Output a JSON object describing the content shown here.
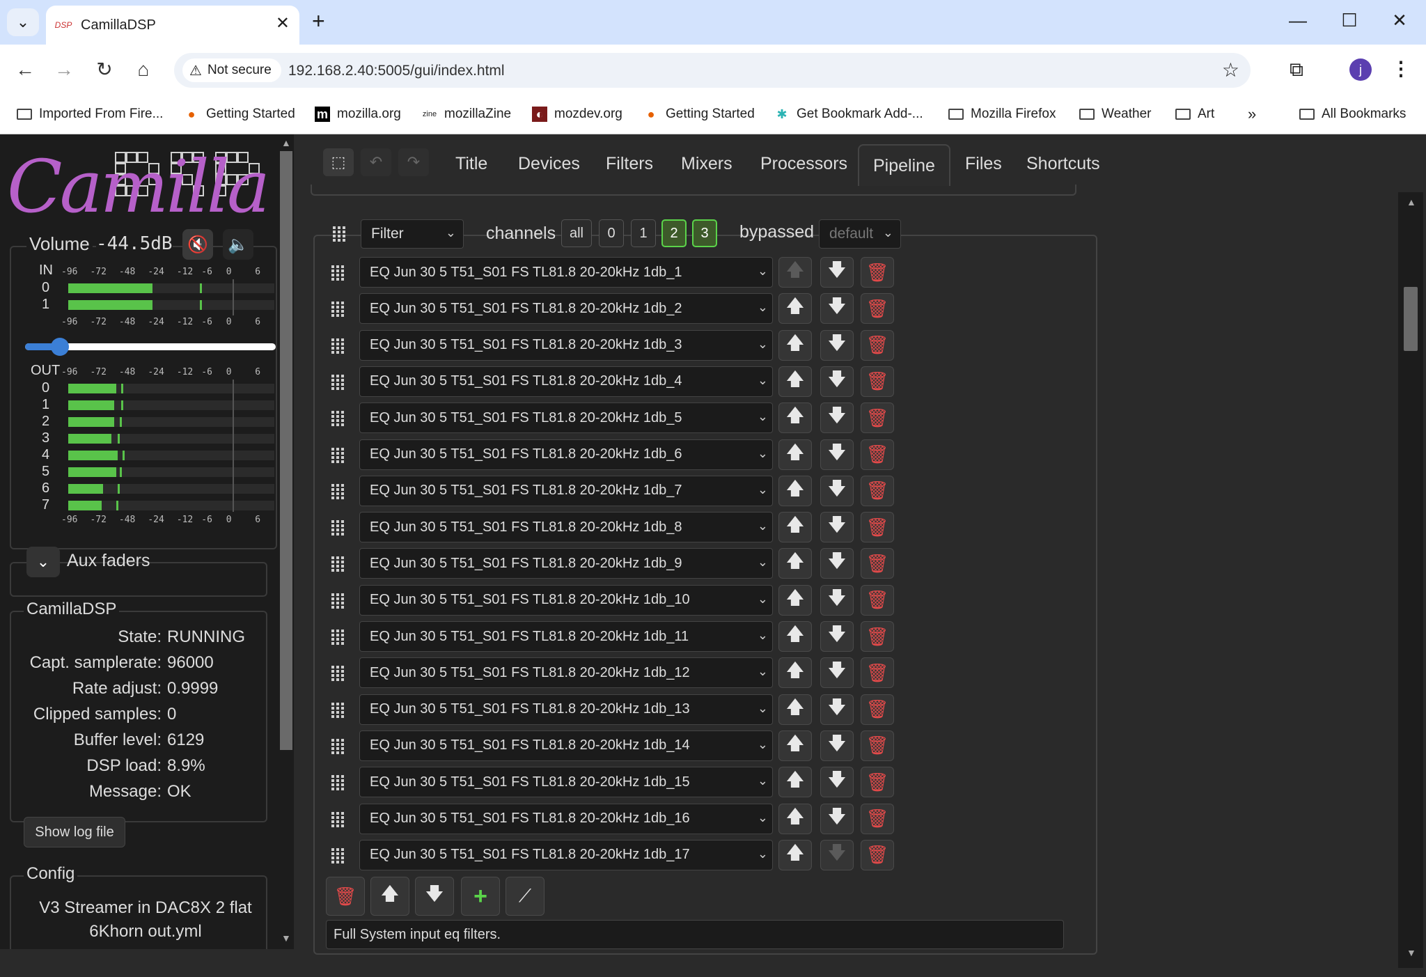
{
  "browser": {
    "tab_title": "CamillaDSP",
    "tab_favicon_text": "DSP",
    "security_label": "Not secure",
    "url": "192.168.2.40:5005/gui/index.html",
    "avatar_letter": "j",
    "bookmarks": [
      {
        "label": "Imported From Fire...",
        "icon": "folder-icon"
      },
      {
        "label": "Getting Started",
        "icon": "firefox-icon"
      },
      {
        "label": "mozilla.org",
        "icon": "mozilla-m-icon"
      },
      {
        "label": "mozillaZine",
        "icon": "mozillazine-icon"
      },
      {
        "label": "mozdev.org",
        "icon": "mozdev-icon"
      },
      {
        "label": "Getting Started",
        "icon": "firefox-icon"
      },
      {
        "label": "Get Bookmark Add-...",
        "icon": "puzzle-icon"
      },
      {
        "label": "Mozilla Firefox",
        "icon": "folder-icon"
      },
      {
        "label": "Weather",
        "icon": "folder-icon"
      },
      {
        "label": "Art",
        "icon": "folder-icon"
      }
    ],
    "bookmarks_more": "»",
    "all_bookmarks": "All Bookmarks"
  },
  "sidebar": {
    "logo": "CamillaDSP",
    "volume_label": "Volume",
    "volume_value": "-44.5dB",
    "volume_slider_fraction": 0.14,
    "meter_in_label": "IN",
    "meter_out_label": "OUT",
    "meter_ticks": [
      "-96",
      "-72",
      "-48",
      "-24",
      "-12",
      "-6",
      "0",
      "6"
    ],
    "in_channels": [
      {
        "label": "0",
        "level_db": -26,
        "peak_db": -8
      },
      {
        "label": "1",
        "level_db": -26,
        "peak_db": -8
      }
    ],
    "out_channels": [
      {
        "label": "0",
        "level_db": -56,
        "peak_db": -52
      },
      {
        "label": "1",
        "level_db": -58,
        "peak_db": -52
      },
      {
        "label": "2",
        "level_db": -58,
        "peak_db": -53
      },
      {
        "label": "3",
        "level_db": -60,
        "peak_db": -55
      },
      {
        "label": "4",
        "level_db": -55,
        "peak_db": -51
      },
      {
        "label": "5",
        "level_db": -56,
        "peak_db": -53
      },
      {
        "label": "6",
        "level_db": -67,
        "peak_db": -55
      },
      {
        "label": "7",
        "level_db": -68,
        "peak_db": -56
      }
    ],
    "aux_faders_label": "Aux faders",
    "status_title": "CamillaDSP",
    "status": [
      {
        "key": "State:",
        "value": "RUNNING"
      },
      {
        "key": "Capt. samplerate:",
        "value": "96000"
      },
      {
        "key": "Rate adjust:",
        "value": "0.9999"
      },
      {
        "key": "Clipped samples:",
        "value": "0"
      },
      {
        "key": "Buffer level:",
        "value": "6129"
      },
      {
        "key": "DSP load:",
        "value": "8.9%"
      },
      {
        "key": "Message:",
        "value": "OK"
      }
    ],
    "show_log_label": "Show log file",
    "config_title": "Config",
    "config_file": "V3 Streamer in DAC8X 2 flat 6Khorn out.yml"
  },
  "main": {
    "tabs": [
      "Title",
      "Devices",
      "Filters",
      "Mixers",
      "Processors",
      "Pipeline",
      "Files",
      "Shortcuts"
    ],
    "active_tab": "Pipeline",
    "step_type": "Filter",
    "channels_label": "channels",
    "channel_buttons": [
      {
        "label": "all",
        "on": false
      },
      {
        "label": "0",
        "on": false
      },
      {
        "label": "1",
        "on": false
      },
      {
        "label": "2",
        "on": true
      },
      {
        "label": "3",
        "on": true
      }
    ],
    "bypassed_label": "bypassed",
    "bypassed_value": "default",
    "filters": [
      "EQ Jun 30 5 T51_S01 FS TL81.8 20-20kHz 1db_1",
      "EQ Jun 30 5 T51_S01 FS TL81.8 20-20kHz 1db_2",
      "EQ Jun 30 5 T51_S01 FS TL81.8 20-20kHz 1db_3",
      "EQ Jun 30 5 T51_S01 FS TL81.8 20-20kHz 1db_4",
      "EQ Jun 30 5 T51_S01 FS TL81.8 20-20kHz 1db_5",
      "EQ Jun 30 5 T51_S01 FS TL81.8 20-20kHz 1db_6",
      "EQ Jun 30 5 T51_S01 FS TL81.8 20-20kHz 1db_7",
      "EQ Jun 30 5 T51_S01 FS TL81.8 20-20kHz 1db_8",
      "EQ Jun 30 5 T51_S01 FS TL81.8 20-20kHz 1db_9",
      "EQ Jun 30 5 T51_S01 FS TL81.8 20-20kHz 1db_10",
      "EQ Jun 30 5 T51_S01 FS TL81.8 20-20kHz 1db_11",
      "EQ Jun 30 5 T51_S01 FS TL81.8 20-20kHz 1db_12",
      "EQ Jun 30 5 T51_S01 FS TL81.8 20-20kHz 1db_13",
      "EQ Jun 30 5 T51_S01 FS TL81.8 20-20kHz 1db_14",
      "EQ Jun 30 5 T51_S01 FS TL81.8 20-20kHz 1db_15",
      "EQ Jun 30 5 T51_S01 FS TL81.8 20-20kHz 1db_16",
      "EQ Jun 30 5 T51_S01 FS TL81.8 20-20kHz 1db_17"
    ],
    "description": "Full System input eq filters.",
    "colors": {
      "accent_green": "#5bd44a",
      "danger_red": "#e24a4a",
      "meter_green": "#59c34a",
      "slider_blue": "#3b7fd6"
    }
  }
}
